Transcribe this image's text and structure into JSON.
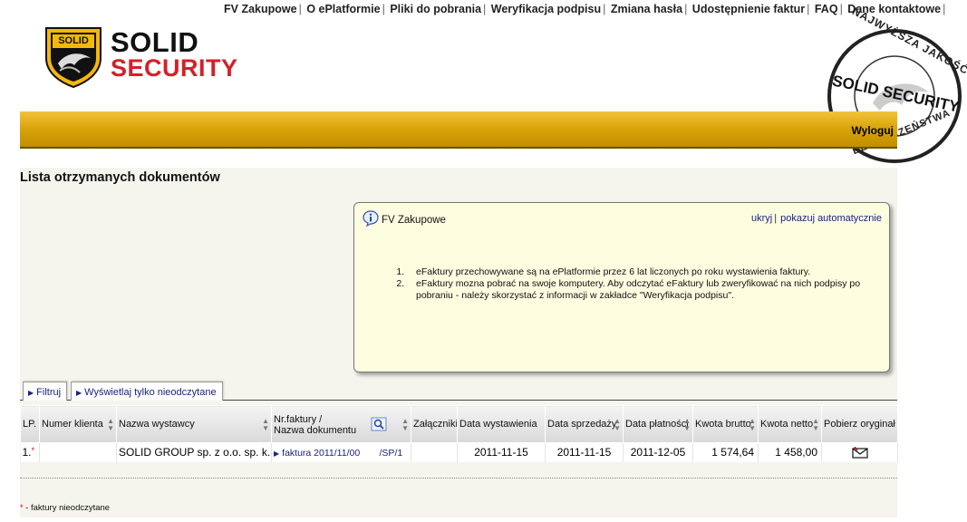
{
  "top_nav": [
    "FV Zakupowe",
    "O ePlatformie",
    "Pliki do pobrania",
    "Weryfikacja podpisu",
    "Zmiana hasła",
    "Udostępnienie faktur",
    "FAQ",
    "Dane kontaktowe"
  ],
  "logo": {
    "line1": "SOLID",
    "line2": "SECURITY",
    "shield_text": "SOLID"
  },
  "stamp": {
    "top_text": "NAJWYŻSZA JAKOŚĆ",
    "middle_text": "SOLID SECURITY",
    "bottom_text": "BEZPIECZEŃSTWA"
  },
  "header": {
    "logout_label": "Wyloguj"
  },
  "page": {
    "title": "Lista otrzymanych dokumentów"
  },
  "info_box": {
    "title": "FV Zakupowe",
    "hide_label": "ukryj",
    "auto_label": "pokazuj automatycznie",
    "items": [
      "eFaktury przechowywane są na ePlatformie przez 6 lat liczonych po roku wystawienia faktury.",
      "eFaktury mozna pobrać na swoje komputery. Aby odczytać eFaktury lub zweryfikować na nich podpisy po pobraniu - należy skorzystać z informacji w zakładce \"Weryfikacja podpisu\"."
    ]
  },
  "tabs": {
    "filter": "Filtruj",
    "unread": "Wyświetlaj tylko nieodczytane"
  },
  "table": {
    "headers": {
      "lp": "LP.",
      "client_no": "Numer klienta",
      "issuer": "Nazwa wystawcy",
      "invoice_line1": "Nr.faktury /",
      "invoice_line2": "Nazwa dokumentu",
      "attachments": "Załączniki",
      "issue_date": "Data wystawienia",
      "sale_date": "Data sprzedaży",
      "pay_date": "Data płatności",
      "gross": "Kwota brutto",
      "net": "Kwota netto",
      "download": "Pobierz oryginał"
    },
    "rows": [
      {
        "lp": "1.",
        "star": "*",
        "client_no": "",
        "issuer": "SOLID GROUP sp. z o.o. sp. k.",
        "invoice": "faktura 2011/11/00",
        "invoice_suffix": "/SP/1",
        "issue_date": "2011-11-15",
        "sale_date": "2011-11-15",
        "pay_date": "2011-12-05",
        "gross": "1 574,64",
        "net": "1 458,00"
      }
    ]
  },
  "legend": {
    "star": "*",
    "text": " - faktury nieodczytane"
  },
  "colors": {
    "bar": "#d9a307",
    "link": "#1a237e",
    "logo_red": "#d4202a",
    "infobox_bg": "#fdfde0"
  }
}
